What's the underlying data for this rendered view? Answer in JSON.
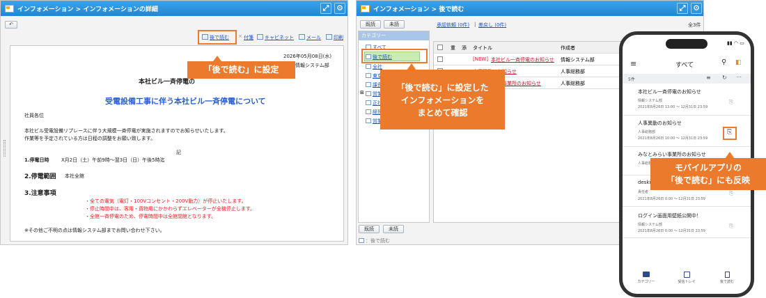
{
  "left_window": {
    "breadcrumb": "インフォメーション > インフォメーションの詳細",
    "toolbar": {
      "read_later": "後で読む",
      "tag": "付箋",
      "cabinet": "キャビネット",
      "mail": "メール",
      "print": "印刷"
    },
    "document": {
      "date": "2026年05月08日(水)",
      "department": "情報システム部",
      "title_partial": "本社ビル一斉停電の",
      "heading": "受電設備工事に伴う本社ビル一斉停電について",
      "greeting": "社員各位",
      "body_line1": "本社ビル受電設備リプレースに伴う大規模一斉停電が実施されますのでお知らせいたします。",
      "body_line2": "作業等を予定されている方は日程の調整をお願い致します。",
      "ki": "記",
      "s1_label": "1.停電日時",
      "s1_value": "X月2日（土）午前9時～翌3日（日）午後5時迄",
      "s2_label": "2.停電範囲",
      "s2_value": "本社全館",
      "s3_label": "3.注意事項",
      "notes": [
        "・全ての電気（電灯・100Vコンセント・200V動力）が停止いたします。",
        "・停止時間中は、客用・貨物用にかかわらずエレベーターが全機停止します。",
        "・全館一斉停電のため、停電時間中は全館閉館となります。"
      ],
      "footer": "※その他ご不明の点は情報システム部までお問い合わせ下さい。"
    }
  },
  "callouts": {
    "c1": "「後で読む」に設定",
    "c2_lines": [
      "「後で読む」に設定した",
      "インフォメーションを",
      "まとめて確認"
    ],
    "c3_lines": [
      "モバイルアプリの",
      "「後で読む」にも反映"
    ]
  },
  "mid_window": {
    "breadcrumb": "インフォメーション > 後で読む",
    "btn_read": "既読",
    "btn_unread": "未読",
    "approval_link": "承認依頼 (0件)",
    "sep": "|",
    "returned_link": "差戻し (0件)",
    "total": "全3件",
    "category_header": "カテゴリー",
    "categories": [
      "すべて",
      "後で読む",
      "全社",
      "東京本社",
      "課長以上",
      "営業",
      "正社員",
      "経理",
      "営業"
    ],
    "columns": [
      "重",
      "添",
      "タイトル",
      "作成者"
    ],
    "rows": [
      {
        "new": "[NEW]",
        "title": "本社ビル一斉停電のお知らせ",
        "author": "情報システム部"
      },
      {
        "new": "",
        "title": "人事異動のお知らせ",
        "author": "人事総務部"
      },
      {
        "new": "",
        "title": "みなとみらい事業所のお知らせ",
        "author": "人事総務部"
      }
    ],
    "bottom_read": "既読",
    "bottom_unread": "未読",
    "legend": "：後で読む"
  },
  "phone": {
    "title": "すべて",
    "count": "5件",
    "items": [
      {
        "title": "本社ビル一斉停電のお知らせ",
        "dept": "情報システム部",
        "date": "2021年8月26日 13:00 ～ 12月31日 23:59"
      },
      {
        "title": "人事異動のお知らせ",
        "dept": "人事総務部",
        "date": "2021年8月26日 10:00 ～ 12月31日 23:59"
      },
      {
        "title": "みなとみらい事業所のお知らせ",
        "dept": "人事総務部",
        "date": ""
      },
      {
        "title": "deskn",
        "dept": "責任者",
        "date": "2021年8月26日 0:00 ～ 12月31日 23:59"
      },
      {
        "title": "ログイン画面用壁紙公開中！",
        "dept": "情報システム部",
        "date": "2021年8月26日 0:00 ～ 12月31日 23:59"
      }
    ],
    "tabs": [
      "カテゴリー",
      "受信トレイ",
      "後で読む"
    ]
  }
}
